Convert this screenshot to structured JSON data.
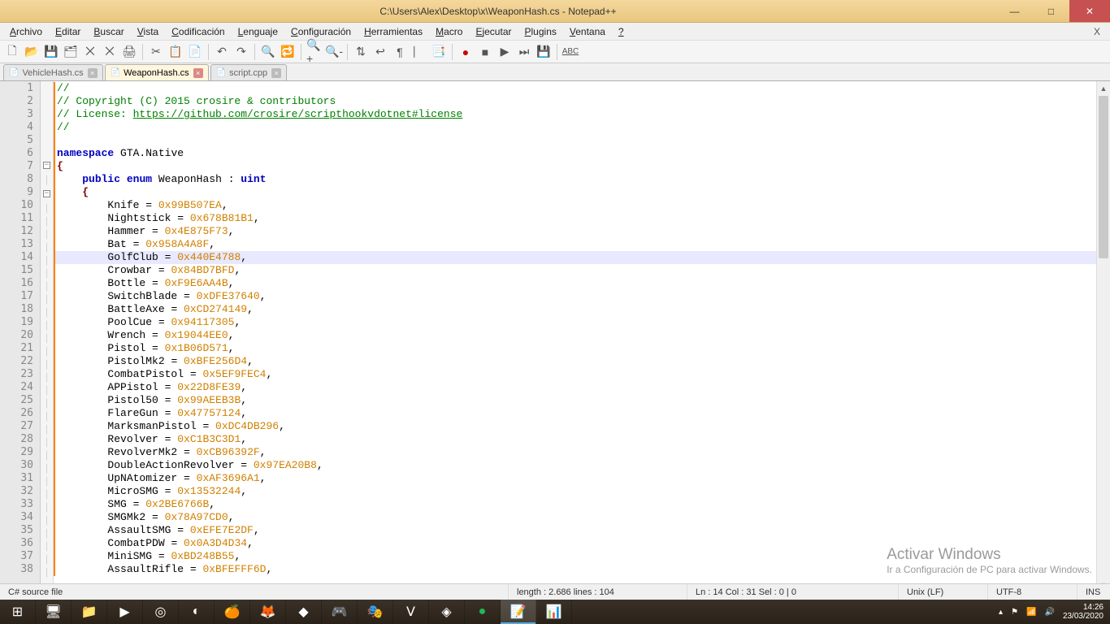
{
  "window": {
    "title": "C:\\Users\\Alex\\Desktop\\x\\WeaponHash.cs - Notepad++"
  },
  "menu": {
    "items": [
      "Archivo",
      "Editar",
      "Buscar",
      "Vista",
      "Codificación",
      "Lenguaje",
      "Configuración",
      "Herramientas",
      "Macro",
      "Ejecutar",
      "Plugins",
      "Ventana",
      "?"
    ]
  },
  "tabs": [
    {
      "label": "VehicleHash.cs",
      "active": false
    },
    {
      "label": "WeaponHash.cs",
      "active": true
    },
    {
      "label": "script.cpp",
      "active": false
    }
  ],
  "status": {
    "filetype": "C# source file",
    "length": "length : 2.686    lines : 104",
    "pos": "Ln : 14    Col : 31    Sel : 0 | 0",
    "eol": "Unix (LF)",
    "enc": "UTF-8",
    "ins": "INS"
  },
  "watermark": {
    "title": "Activar Windows",
    "sub": "Ir a Configuración de PC para activar Windows."
  },
  "tray": {
    "time": "14:26",
    "date": "23/03/2020"
  },
  "highlight_line": 14,
  "code": {
    "license_prefix": "// License: ",
    "license_url": "https://github.com/crosire/scripthookvdotnet#license",
    "copyright": "// Copyright (C) 2015 crosire & contributors",
    "namespace": "GTA.Native",
    "enum_name": "WeaponHash",
    "enum_type": "uint",
    "entries": [
      {
        "name": "Knife",
        "value": "0x99B507EA"
      },
      {
        "name": "Nightstick",
        "value": "0x678B81B1"
      },
      {
        "name": "Hammer",
        "value": "0x4E875F73"
      },
      {
        "name": "Bat",
        "value": "0x958A4A8F"
      },
      {
        "name": "GolfClub",
        "value": "0x440E4788"
      },
      {
        "name": "Crowbar",
        "value": "0x84BD7BFD"
      },
      {
        "name": "Bottle",
        "value": "0xF9E6AA4B"
      },
      {
        "name": "SwitchBlade",
        "value": "0xDFE37640"
      },
      {
        "name": "BattleAxe",
        "value": "0xCD274149"
      },
      {
        "name": "PoolCue",
        "value": "0x94117305"
      },
      {
        "name": "Wrench",
        "value": "0x19044EE0"
      },
      {
        "name": "Pistol",
        "value": "0x1B06D571"
      },
      {
        "name": "PistolMk2",
        "value": "0xBFE256D4"
      },
      {
        "name": "CombatPistol",
        "value": "0x5EF9FEC4"
      },
      {
        "name": "APPistol",
        "value": "0x22D8FE39"
      },
      {
        "name": "Pistol50",
        "value": "0x99AEEB3B"
      },
      {
        "name": "FlareGun",
        "value": "0x47757124"
      },
      {
        "name": "MarksmanPistol",
        "value": "0xDC4DB296"
      },
      {
        "name": "Revolver",
        "value": "0xC1B3C3D1"
      },
      {
        "name": "RevolverMk2",
        "value": "0xCB96392F"
      },
      {
        "name": "DoubleActionRevolver",
        "value": "0x97EA20B8"
      },
      {
        "name": "UpNAtomizer",
        "value": "0xAF3696A1"
      },
      {
        "name": "MicroSMG",
        "value": "0x13532244"
      },
      {
        "name": "SMG",
        "value": "0x2BE6766B"
      },
      {
        "name": "SMGMk2",
        "value": "0x78A97CD0"
      },
      {
        "name": "AssaultSMG",
        "value": "0xEFE7E2DF"
      },
      {
        "name": "CombatPDW",
        "value": "0x0A3D4D34"
      },
      {
        "name": "MiniSMG",
        "value": "0xBD248B55"
      },
      {
        "name": "AssaultRifle",
        "value": "0xBFEFFF6D"
      }
    ]
  }
}
